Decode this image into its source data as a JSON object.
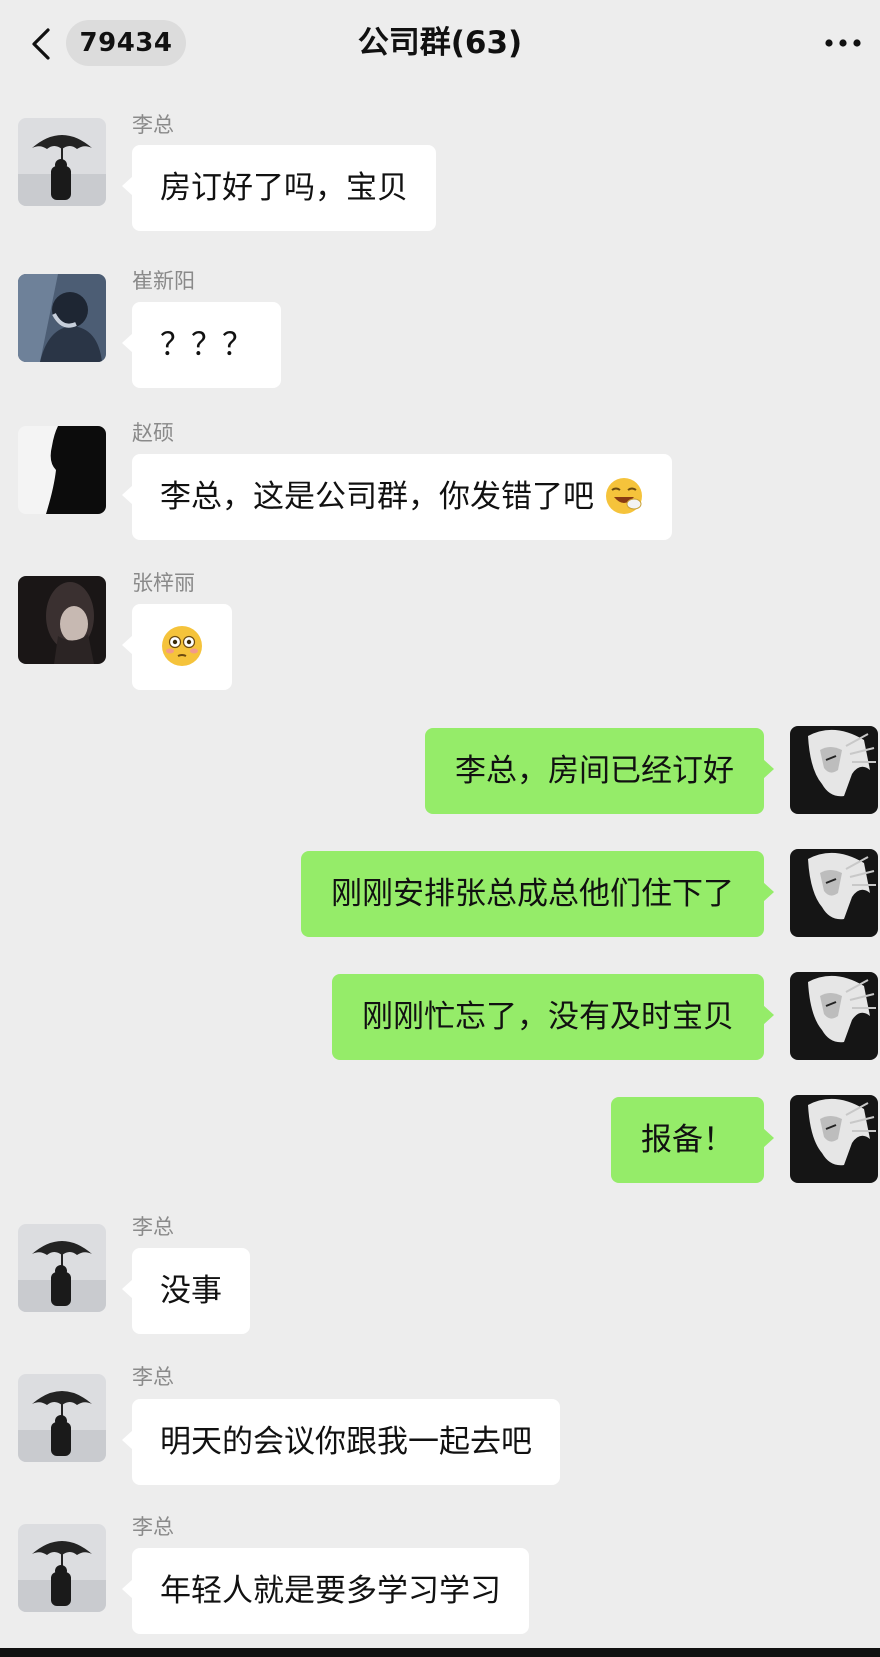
{
  "nav": {
    "unread_count": "79434",
    "title": "公司群(63)",
    "back_icon": "chevron-left-icon",
    "more_icon": "more-dots-icon"
  },
  "messages": [
    {
      "direction": "in",
      "sender": "李总",
      "text": "房订好了吗，宝贝"
    },
    {
      "direction": "in",
      "sender": "崔新阳",
      "text": "？？？"
    },
    {
      "direction": "in",
      "sender": "赵硕",
      "text": "李总，这是公司群，你发错了吧",
      "emoji": "laughing-emoji"
    },
    {
      "direction": "in",
      "sender": "张梓丽",
      "text": "",
      "emoji": "flushed-emoji"
    },
    {
      "direction": "out",
      "text": "李总，房间已经订好"
    },
    {
      "direction": "out",
      "text": "刚刚安排张总成总他们住下了"
    },
    {
      "direction": "out",
      "text": "刚刚忙忘了，没有及时宝贝"
    },
    {
      "direction": "out",
      "text": "报备！"
    },
    {
      "direction": "in",
      "sender": "李总",
      "text": "没事"
    },
    {
      "direction": "in",
      "sender": "李总",
      "text": "明天的会议你跟我一起去吧"
    },
    {
      "direction": "in",
      "sender": "李总",
      "text": "年轻人就是要多学习学习"
    }
  ],
  "colors": {
    "background": "#ededed",
    "incoming_bubble": "#ffffff",
    "outgoing_bubble": "#95ec69",
    "sender_name": "#8a8a8a"
  }
}
